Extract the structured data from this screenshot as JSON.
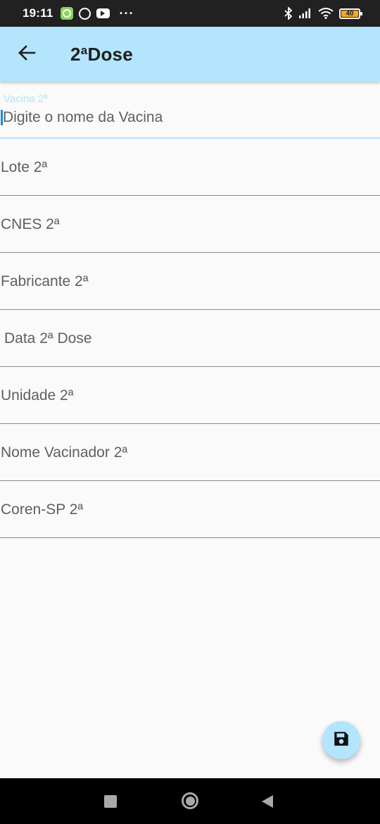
{
  "status_bar": {
    "time": "19:11",
    "battery_level": "40",
    "icons": [
      "app-notification-icon",
      "whatsapp-icon",
      "youtube-icon",
      "more-dots-icon",
      "bluetooth-icon",
      "signal-icon",
      "wifi-icon",
      "battery-icon"
    ]
  },
  "app_bar": {
    "title": "2ªDose",
    "back_icon": "arrow-left-icon",
    "background_color": "#b3e5fc"
  },
  "form": {
    "vaccine_field": {
      "label": "Vacina 2ª",
      "placeholder": "Digite o nome da Vacina"
    },
    "fields": [
      {
        "placeholder": "Lote 2ª"
      },
      {
        "placeholder": "CNES 2ª"
      },
      {
        "placeholder": "Fabricante 2ª"
      },
      {
        "placeholder": "Data 2ª Dose"
      },
      {
        "placeholder": "Unidade 2ª"
      },
      {
        "placeholder": "Nome Vacinador 2ª"
      },
      {
        "placeholder": "Coren-SP 2ª"
      }
    ]
  },
  "fab": {
    "icon": "save-icon",
    "color": "#b3e5fc"
  },
  "nav_bar": {
    "icons": [
      "recents-square-icon",
      "home-circle-icon",
      "back-triangle-icon"
    ]
  }
}
